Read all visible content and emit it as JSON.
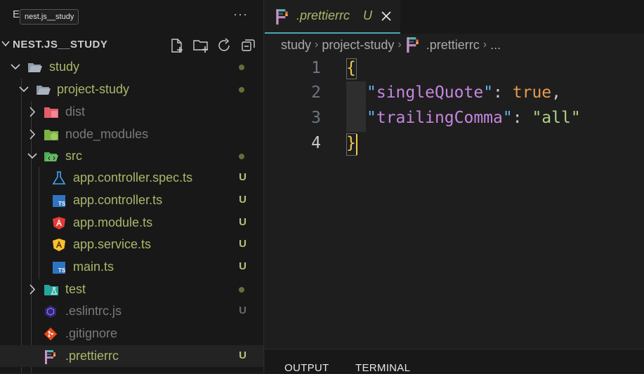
{
  "sidebar": {
    "title": "E",
    "tooltip": "nest.js__study",
    "more_label": "···",
    "folder_name": "NEST.JS__STUDY",
    "header_buttons": [
      "new-file-icon",
      "new-folder-icon",
      "refresh-icon",
      "collapse-all-icon"
    ],
    "tree": [
      {
        "label": "study",
        "status": "dot",
        "icon": "folder-open-icon",
        "kind": "folder-open"
      },
      {
        "label": "project-study",
        "status": "dot",
        "icon": "folder-open-icon",
        "kind": "folder-open"
      },
      {
        "label": "dist",
        "status": "",
        "icon": "folder-dist-icon",
        "kind": "folder-closed"
      },
      {
        "label": "node_modules",
        "status": "",
        "icon": "folder-node-icon",
        "kind": "folder-closed"
      },
      {
        "label": "src",
        "status": "dot",
        "icon": "folder-src-icon",
        "kind": "folder-open"
      },
      {
        "label": "app.controller.spec.ts",
        "status": "U",
        "icon": "test-flask-icon",
        "kind": "file"
      },
      {
        "label": "app.controller.ts",
        "status": "U",
        "icon": "typescript-icon",
        "kind": "file"
      },
      {
        "label": "app.module.ts",
        "status": "U",
        "icon": "angular-red-icon",
        "kind": "file"
      },
      {
        "label": "app.service.ts",
        "status": "U",
        "icon": "angular-yellow-icon",
        "kind": "file"
      },
      {
        "label": "main.ts",
        "status": "U",
        "icon": "typescript-icon",
        "kind": "file"
      },
      {
        "label": "test",
        "status": "dot",
        "icon": "folder-test-icon",
        "kind": "folder-closed"
      },
      {
        "label": ".eslintrc.js",
        "status": "U",
        "icon": "eslint-icon",
        "kind": "file"
      },
      {
        "label": ".gitignore",
        "status": "",
        "icon": "git-icon",
        "kind": "file"
      },
      {
        "label": ".prettierrc",
        "status": "U",
        "icon": "prettier-icon",
        "kind": "file"
      }
    ]
  },
  "editor": {
    "tab": {
      "label": ".prettierrc",
      "status": "U",
      "icon": "prettier-icon"
    },
    "breadcrumb": [
      "study",
      "project-study",
      ".prettierrc",
      "..."
    ],
    "lines": [
      {
        "num": "1",
        "open": "{"
      },
      {
        "num": "2",
        "key": "singleQuote",
        "value": "true",
        "value_type": "bool"
      },
      {
        "num": "3",
        "key": "trailingComma",
        "value": "all",
        "value_type": "string"
      },
      {
        "num": "4",
        "close": "}"
      }
    ]
  },
  "panel": {
    "tabs": [
      "OUTPUT",
      "TERMINAL"
    ]
  },
  "colors": {
    "accent": "#4aa5b8",
    "untracked": "#a8b86a",
    "brace": "#f2c94c"
  }
}
